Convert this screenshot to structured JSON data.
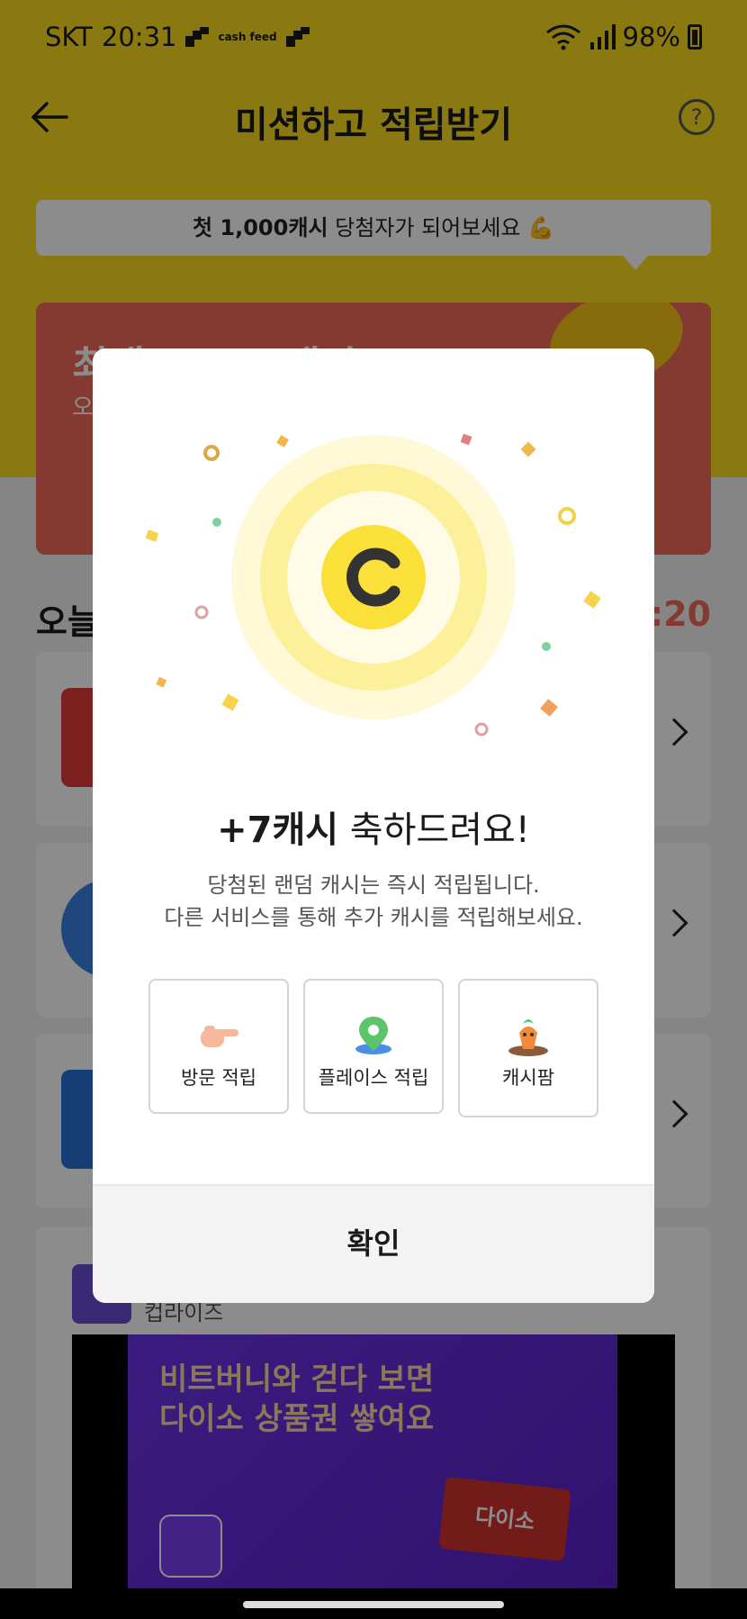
{
  "status": {
    "carrier": "SKT",
    "time": "20:31",
    "mini_logo": "cash feed",
    "battery": "98%"
  },
  "appbar": {
    "title": "미션하고 적립받기",
    "help": "?"
  },
  "promo": {
    "strong": "첫 1,000캐시",
    "rest": " 당첨자가 되어보세요 💪"
  },
  "background": {
    "red_card_title": "최대 1,000캐시",
    "red_card_sub": "오",
    "section_title": "오늘",
    "section_timer": "9:20",
    "ad_name": "컵라이즈",
    "ad_headline_1": "비트버니와 걷다 보면",
    "ad_headline_2": "다이소 상품권 쌓여요",
    "ad_badge": "다이소"
  },
  "modal": {
    "coin_letter": "C",
    "title_amount": "+7캐시",
    "title_rest": " 축하드려요!",
    "desc_line1": "당첨된 랜덤 캐시는 즉시 적립됩니다.",
    "desc_line2": "다른 서비스를 통해 추가 캐시를 적립해보세요.",
    "shortcuts": [
      {
        "label": "방문 적립",
        "icon": "pointing-hand-icon"
      },
      {
        "label": "플레이스 적립",
        "icon": "map-pin-icon"
      },
      {
        "label": "캐시팜",
        "icon": "carrot-icon"
      }
    ],
    "confirm": "확인"
  },
  "colors": {
    "brand_yellow": "#fbdd1f",
    "coin_yellow": "#fbe03a",
    "promo_red": "#f06a5a"
  }
}
